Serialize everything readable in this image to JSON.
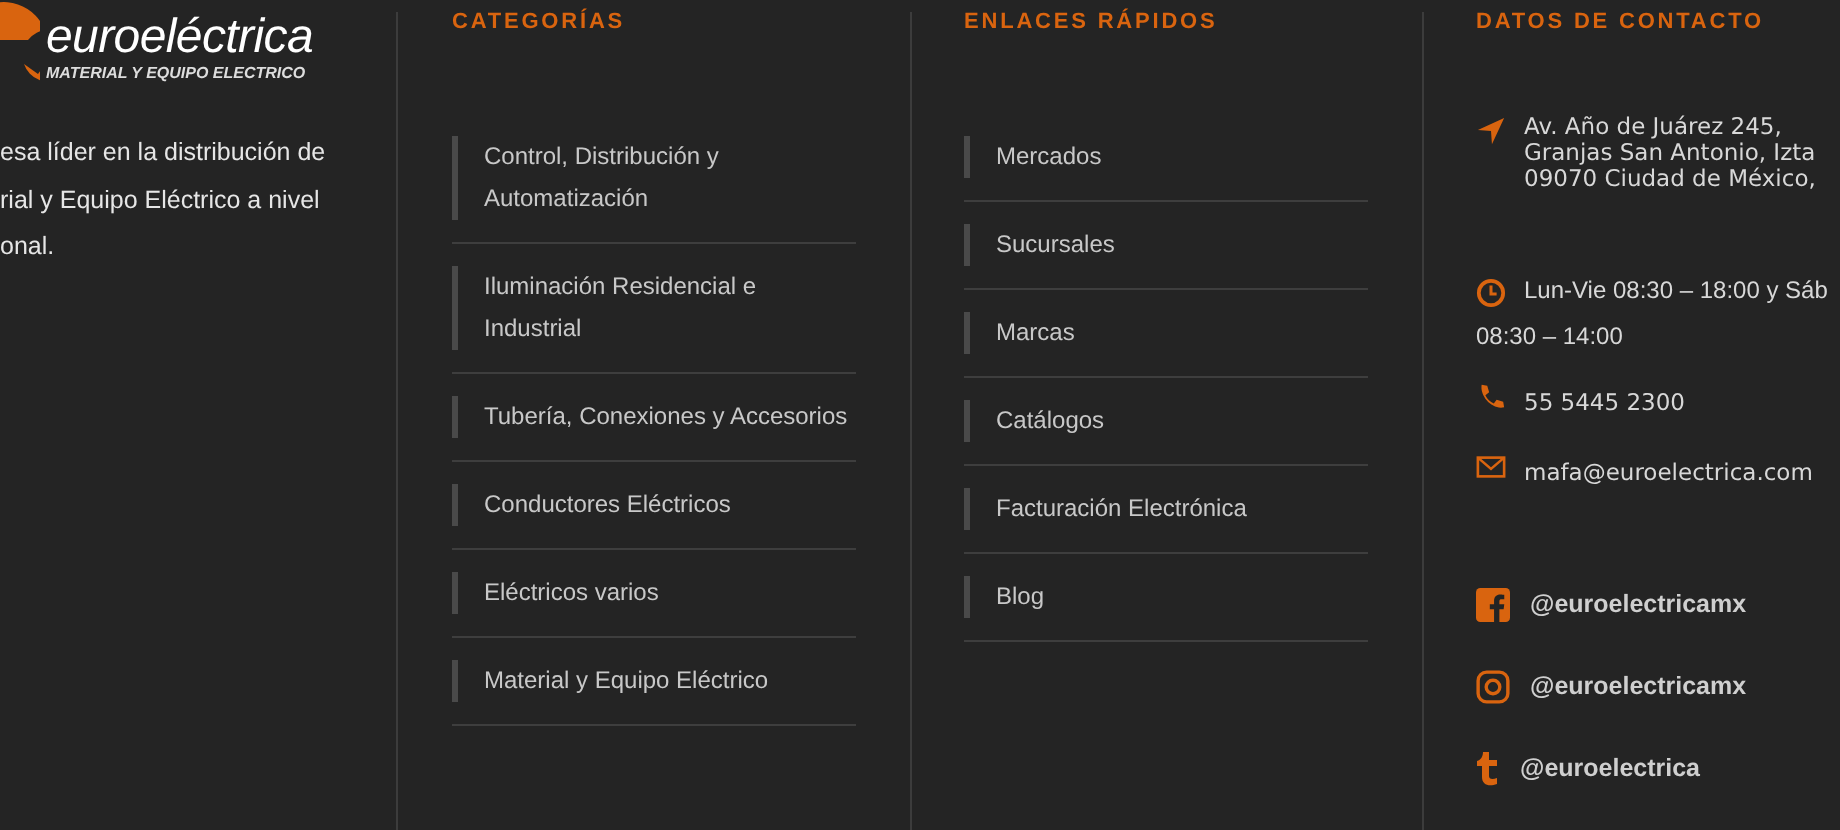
{
  "brand": {
    "name": "euroeléctrica",
    "tagline": "MATERIAL Y EQUIPO ELECTRICO",
    "description": [
      "esa líder en la distribución de",
      "rial y Equipo Eléctrico a nivel",
      "onal."
    ]
  },
  "categories": {
    "heading": "CATEGORÍAS",
    "items": [
      [
        "Control, Distribución y",
        "Automatización"
      ],
      [
        "Iluminación Residencial e",
        "Industrial"
      ],
      [
        "Tubería, Conexiones y Accesorios"
      ],
      [
        "Conductores Eléctricos"
      ],
      [
        "Eléctricos varios"
      ],
      [
        "Material y Equipo Eléctrico"
      ]
    ]
  },
  "quick_links": {
    "heading": "ENLACES RÁPIDOS",
    "items": [
      "Mercados",
      "Sucursales",
      "Marcas",
      "Catálogos",
      "Facturación Electrónica",
      "Blog"
    ]
  },
  "contact": {
    "heading": "DATOS DE CONTACTO",
    "entries": [
      {
        "kind": "address",
        "lines": [
          "Av. Año de Juárez 245,",
          "Granjas San Antonio, Izta",
          "09070 Ciudad de México,"
        ]
      },
      {
        "kind": "hours",
        "lines": [
          "Lun-Vie 08:30 – 18:00 y Sáb",
          "08:30 – 14:00"
        ]
      },
      {
        "kind": "phone",
        "lines": [
          "55 5445 2300"
        ]
      },
      {
        "kind": "email",
        "lines": [
          "mafa@euroelectrica.com"
        ]
      }
    ],
    "social": [
      {
        "kind": "facebook",
        "handle": "@euroelectricamx"
      },
      {
        "kind": "instagram",
        "handle": "@euroelectricamx"
      },
      {
        "kind": "tumblr",
        "handle": "@euroelectrica"
      }
    ]
  }
}
